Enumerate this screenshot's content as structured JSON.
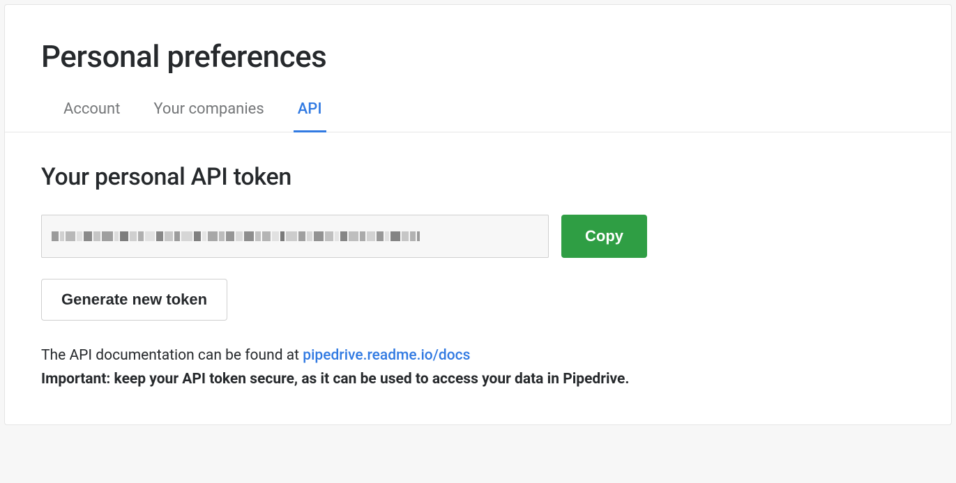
{
  "header": {
    "title": "Personal preferences",
    "tabs": [
      {
        "label": "Account",
        "active": false
      },
      {
        "label": "Your companies",
        "active": false
      },
      {
        "label": "API",
        "active": true
      }
    ]
  },
  "section": {
    "title": "Your personal API token",
    "token_value_masked": true,
    "copy_label": "Copy",
    "generate_label": "Generate new token",
    "doc_text_prefix": "The API documentation can be found at ",
    "doc_link_text": "pipedrive.readme.io/docs",
    "important_text": "Important: keep your API token secure, as it can be used to access your data in Pipedrive."
  }
}
